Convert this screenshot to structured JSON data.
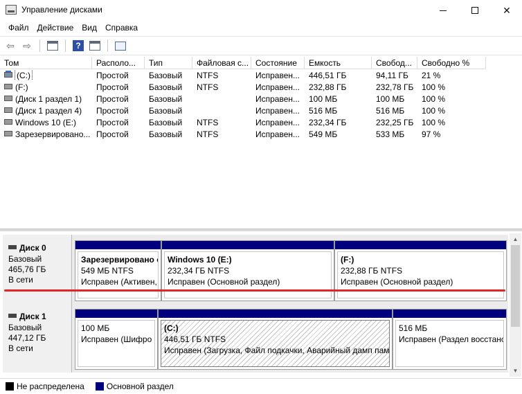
{
  "window": {
    "title": "Управление дисками"
  },
  "menu": [
    "Файл",
    "Действие",
    "Вид",
    "Справка"
  ],
  "toolbar": {
    "icons": [
      "back-arrow-icon",
      "forward-arrow-icon",
      "disk-list-icon",
      "help-icon",
      "console-tree-icon",
      "properties-icon"
    ],
    "help_glyph": "?"
  },
  "volume_list": {
    "columns": [
      "Том",
      "Располо...",
      "Тип",
      "Файловая с...",
      "Состояние",
      "Емкость",
      "Свобод...",
      "Свободно %"
    ],
    "rows": [
      {
        "volume": "(C:)",
        "layout": "Простой",
        "type": "Базовый",
        "fs": "NTFS",
        "status": "Исправен...",
        "capacity": "446,51 ГБ",
        "free": "94,11 ГБ",
        "free_pct": "21 %"
      },
      {
        "volume": "(F:)",
        "layout": "Простой",
        "type": "Базовый",
        "fs": "NTFS",
        "status": "Исправен...",
        "capacity": "232,88 ГБ",
        "free": "232,78 ГБ",
        "free_pct": "100 %"
      },
      {
        "volume": "(Диск 1 раздел 1)",
        "layout": "Простой",
        "type": "Базовый",
        "fs": "",
        "status": "Исправен...",
        "capacity": "100 МБ",
        "free": "100 МБ",
        "free_pct": "100 %"
      },
      {
        "volume": "(Диск 1 раздел 4)",
        "layout": "Простой",
        "type": "Базовый",
        "fs": "",
        "status": "Исправен...",
        "capacity": "516 МБ",
        "free": "516 МБ",
        "free_pct": "100 %"
      },
      {
        "volume": "Windows 10 (E:)",
        "layout": "Простой",
        "type": "Базовый",
        "fs": "NTFS",
        "status": "Исправен...",
        "capacity": "232,34 ГБ",
        "free": "232,25 ГБ",
        "free_pct": "100 %"
      },
      {
        "volume": "Зарезервировано...",
        "layout": "Простой",
        "type": "Базовый",
        "fs": "NTFS",
        "status": "Исправен...",
        "capacity": "549 МБ",
        "free": "533 МБ",
        "free_pct": "97 %"
      }
    ]
  },
  "disks": [
    {
      "name": "Диск 0",
      "type": "Базовый",
      "size": "465,76 ГБ",
      "state": "В сети",
      "partitions": [
        {
          "title": "Зарезервировано с",
          "size_fs": "549 МБ NTFS",
          "status": "Исправен (Активен,"
        },
        {
          "title": "Windows 10  (E:)",
          "size_fs": "232,34 ГБ NTFS",
          "status": "Исправен (Основной раздел)"
        },
        {
          "title": "(F:)",
          "size_fs": "232,88 ГБ NTFS",
          "status": "Исправен (Основной раздел)"
        }
      ]
    },
    {
      "name": "Диск 1",
      "type": "Базовый",
      "size": "447,12 ГБ",
      "state": "В сети",
      "partitions": [
        {
          "title": "",
          "size_fs": "100 МБ",
          "status": "Исправен (Шифро"
        },
        {
          "title": "(C:)",
          "size_fs": "446,51 ГБ NTFS",
          "status": "Исправен (Загрузка, Файл подкачки, Аварийный дамп пам"
        },
        {
          "title": "",
          "size_fs": "516 МБ",
          "status": "Исправен (Раздел восстано"
        }
      ]
    }
  ],
  "legend": [
    {
      "label": "Не распределена",
      "color": "#000000"
    },
    {
      "label": "Основной раздел",
      "color": "#00007f"
    }
  ],
  "colors": {
    "partition_bar": "#00007f",
    "annotation_line": "#e3242b"
  }
}
